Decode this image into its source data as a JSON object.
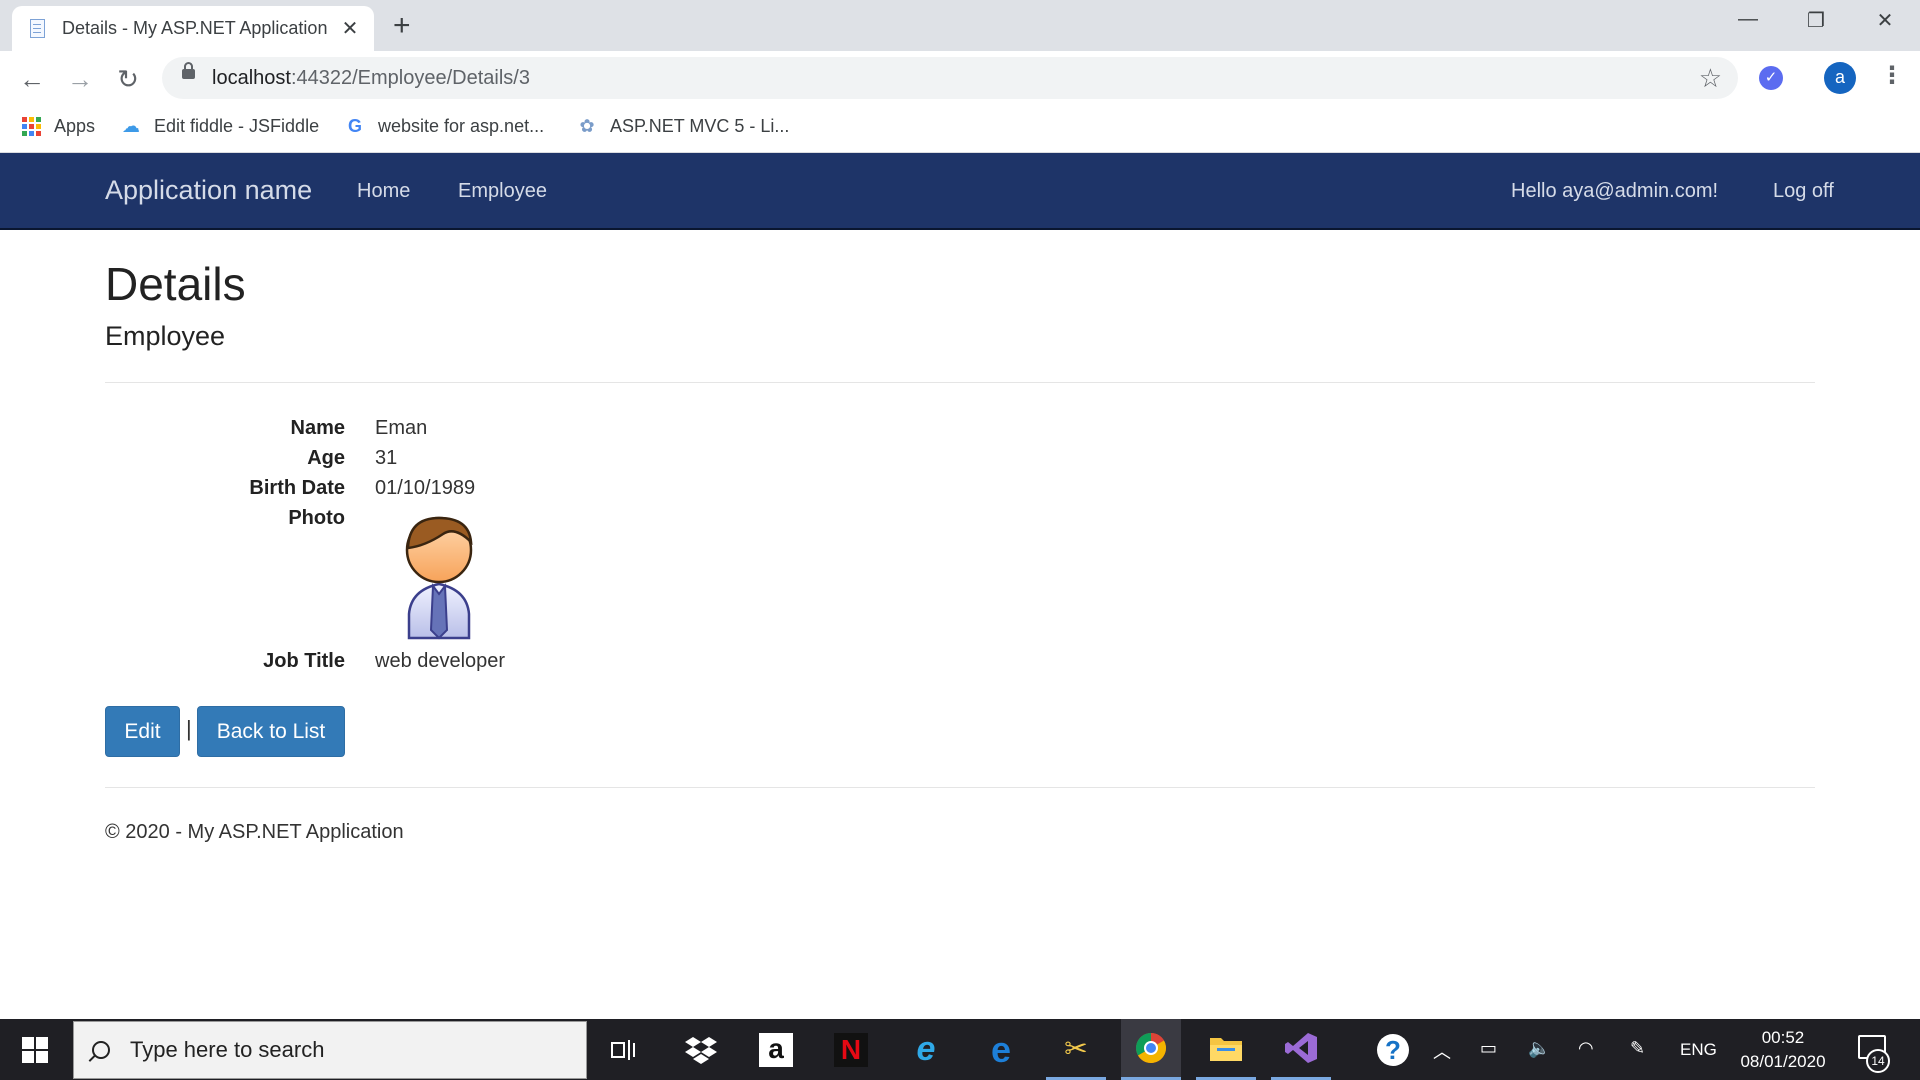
{
  "browser": {
    "tab_title": "Details - My ASP.NET Application",
    "url_host": "localhost",
    "url_path": ":44322/Employee/Details/3",
    "profile_initial": "a",
    "bookmarks": [
      {
        "label": "Apps",
        "icon": "apps-grid-icon"
      },
      {
        "label": "Edit fiddle - JSFiddle",
        "icon": "jsfiddle-cloud-icon"
      },
      {
        "label": "website for asp.net...",
        "icon": "google-g-icon"
      },
      {
        "label": "ASP.NET MVC 5 - Li...",
        "icon": "aspnet-site-icon"
      }
    ]
  },
  "navbar": {
    "brand": "Application name",
    "links": [
      "Home",
      "Employee"
    ],
    "greeting": "Hello aya@admin.com!",
    "logoff": "Log off",
    "bg_color": "#1e3468"
  },
  "page": {
    "title": "Details",
    "subtitle": "Employee",
    "fields": [
      {
        "label": "Name",
        "value": "Eman"
      },
      {
        "label": "Age",
        "value": "31"
      },
      {
        "label": "Birth Date",
        "value": "01/10/1989"
      },
      {
        "label": "Photo",
        "value": ""
      },
      {
        "label": "Job Title",
        "value": "web developer"
      }
    ],
    "photo_icon": "businessman-avatar-icon",
    "edit_label": "Edit",
    "separator": "|",
    "back_label": "Back to List",
    "footer": "© 2020 - My ASP.NET Application",
    "button_color": "#337ab7"
  },
  "taskbar": {
    "search_placeholder": "Type here to search",
    "apps": [
      "task-view-icon",
      "dropbox-icon",
      "amazon-icon",
      "netflix-icon",
      "internet-explorer-icon",
      "edge-icon",
      "snipping-tool-icon",
      "chrome-icon",
      "file-explorer-icon",
      "visual-studio-icon"
    ],
    "language": "ENG",
    "time": "00:52",
    "date": "08/01/2020",
    "notification_count": "14"
  }
}
